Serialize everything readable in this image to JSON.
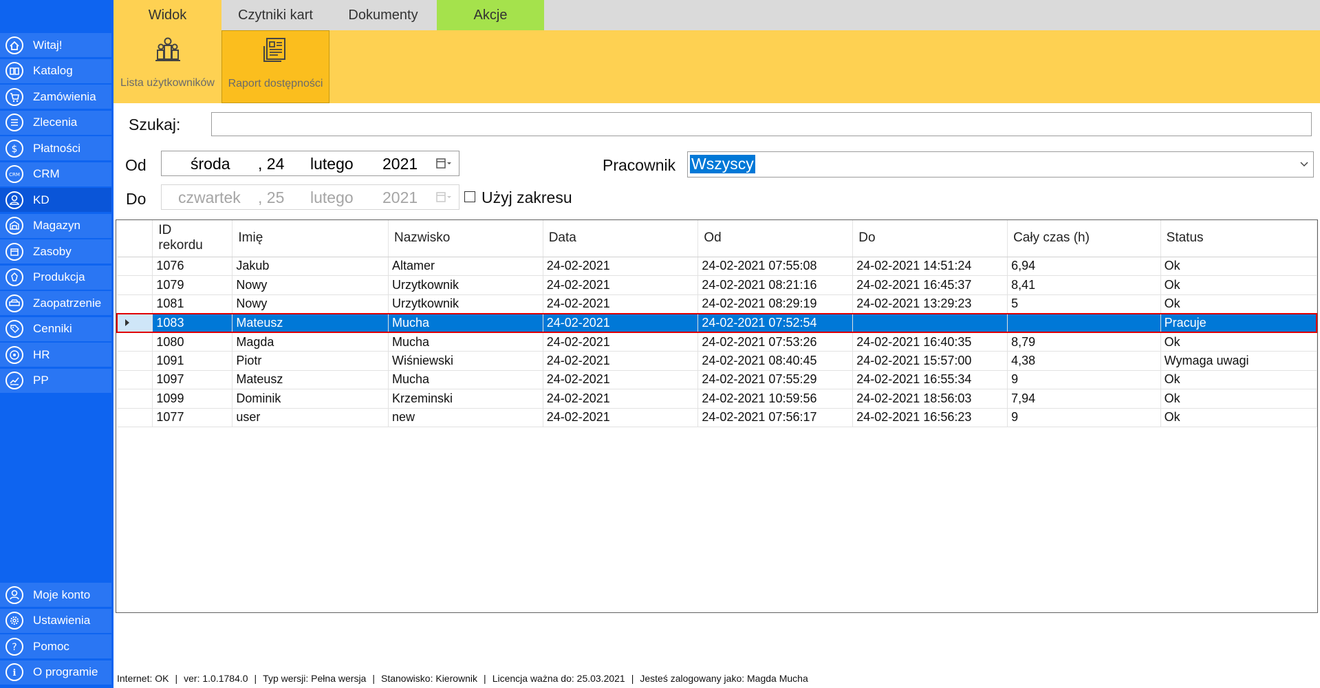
{
  "sidebar": {
    "items": [
      {
        "label": "Witaj!",
        "icon": "home-icon"
      },
      {
        "label": "Katalog",
        "icon": "book-icon"
      },
      {
        "label": "Zamówienia",
        "icon": "cart-icon"
      },
      {
        "label": "Zlecenia",
        "icon": "list-icon"
      },
      {
        "label": "Płatności",
        "icon": "dollar-icon"
      },
      {
        "label": "CRM",
        "icon": "crm-icon"
      },
      {
        "label": "KD",
        "icon": "user-icon"
      },
      {
        "label": "Magazyn",
        "icon": "warehouse-icon"
      },
      {
        "label": "Zasoby",
        "icon": "box-icon"
      },
      {
        "label": "Produkcja",
        "icon": "factory-icon"
      },
      {
        "label": "Zaopatrzenie",
        "icon": "truck-icon"
      },
      {
        "label": "Cenniki",
        "icon": "tag-icon"
      },
      {
        "label": "HR",
        "icon": "target-icon"
      },
      {
        "label": "PP",
        "icon": "chart-icon"
      }
    ],
    "bottom_items": [
      {
        "label": "Moje konto",
        "icon": "account-icon"
      },
      {
        "label": "Ustawienia",
        "icon": "gear-icon"
      },
      {
        "label": "Pomoc",
        "icon": "help-icon"
      },
      {
        "label": "O programie",
        "icon": "info-icon"
      }
    ],
    "active": "KD",
    "color": "#0e64f0"
  },
  "tabs": [
    {
      "label": "Widok"
    },
    {
      "label": "Czytniki kart"
    },
    {
      "label": "Dokumenty"
    },
    {
      "label": "Akcje"
    }
  ],
  "ribbon": {
    "buttons": [
      {
        "label": "Lista użytkowników",
        "icon": "users-icon"
      },
      {
        "label": "Raport dostępności",
        "icon": "report-icon"
      }
    ]
  },
  "filters": {
    "search_label": "Szukaj:",
    "search_value": "",
    "from_label": "Od",
    "from_date": {
      "weekday": "środa",
      "day": ", 24",
      "month": "lutego",
      "year": "2021"
    },
    "to_label": "Do",
    "to_date": {
      "weekday": "czwartek",
      "day": ", 25",
      "month": "lutego",
      "year": "2021"
    },
    "use_range_label": "Użyj zakresu",
    "use_range_checked": false,
    "employee_label": "Pracownik",
    "employee_value": "Wszyscy"
  },
  "table": {
    "columns": [
      "ID rekordu",
      "Imię",
      "Nazwisko",
      "Data",
      "Od",
      "Do",
      "Cały czas (h)",
      "Status"
    ],
    "rows": [
      {
        "id": "1076",
        "first": "Jakub",
        "last": "Altamer",
        "date": "24-02-2021",
        "from": "24-02-2021 07:55:08",
        "to": "24-02-2021 14:51:24",
        "hours": "6,94",
        "status": "Ok"
      },
      {
        "id": "1079",
        "first": "Nowy",
        "last": "Urzytkownik",
        "date": "24-02-2021",
        "from": "24-02-2021 08:21:16",
        "to": "24-02-2021 16:45:37",
        "hours": "8,41",
        "status": "Ok"
      },
      {
        "id": "1081",
        "first": "Nowy",
        "last": "Urzytkownik",
        "date": "24-02-2021",
        "from": "24-02-2021 08:29:19",
        "to": "24-02-2021 13:29:23",
        "hours": "5",
        "status": "Ok"
      },
      {
        "id": "1083",
        "first": "Mateusz",
        "last": "Mucha",
        "date": "24-02-2021",
        "from": "24-02-2021 07:52:54",
        "to": "",
        "hours": "",
        "status": "Pracuje"
      },
      {
        "id": "1080",
        "first": "Magda",
        "last": "Mucha",
        "date": "24-02-2021",
        "from": "24-02-2021 07:53:26",
        "to": "24-02-2021 16:40:35",
        "hours": "8,79",
        "status": "Ok"
      },
      {
        "id": "1091",
        "first": "Piotr",
        "last": "Wiśniewski",
        "date": "24-02-2021",
        "from": "24-02-2021 08:40:45",
        "to": "24-02-2021 15:57:00",
        "hours": "4,38",
        "status": "Wymaga uwagi"
      },
      {
        "id": "1097",
        "first": "Mateusz",
        "last": "Mucha",
        "date": "24-02-2021",
        "from": "24-02-2021 07:55:29",
        "to": "24-02-2021 16:55:34",
        "hours": "9",
        "status": "Ok"
      },
      {
        "id": "1099",
        "first": "Dominik",
        "last": "Krzeminski",
        "date": "24-02-2021",
        "from": "24-02-2021 10:59:56",
        "to": "24-02-2021 18:56:03",
        "hours": "7,94",
        "status": "Ok"
      },
      {
        "id": "1077",
        "first": "user",
        "last": "new",
        "date": "24-02-2021",
        "from": "24-02-2021 07:56:17",
        "to": "24-02-2021 16:56:23",
        "hours": "9",
        "status": "Ok"
      }
    ],
    "selected_row": 3
  },
  "statusbar": {
    "internet": "Internet: OK",
    "version": "ver: 1.0.1784.0",
    "edition": "Typ wersji: Pełna wersja",
    "workstation": "Stanowisko: Kierownik",
    "license": "Licencja ważna do: 25.03.2021",
    "user": "Jesteś zalogowany jako: Magda Mucha"
  },
  "colors": {
    "sidebar": "#0e64f0",
    "ribbon": "#fed152",
    "active_tab": "#fed152",
    "action_tab": "#a5e24c",
    "selection": "#0078d7",
    "selection_border": "#e00000"
  }
}
